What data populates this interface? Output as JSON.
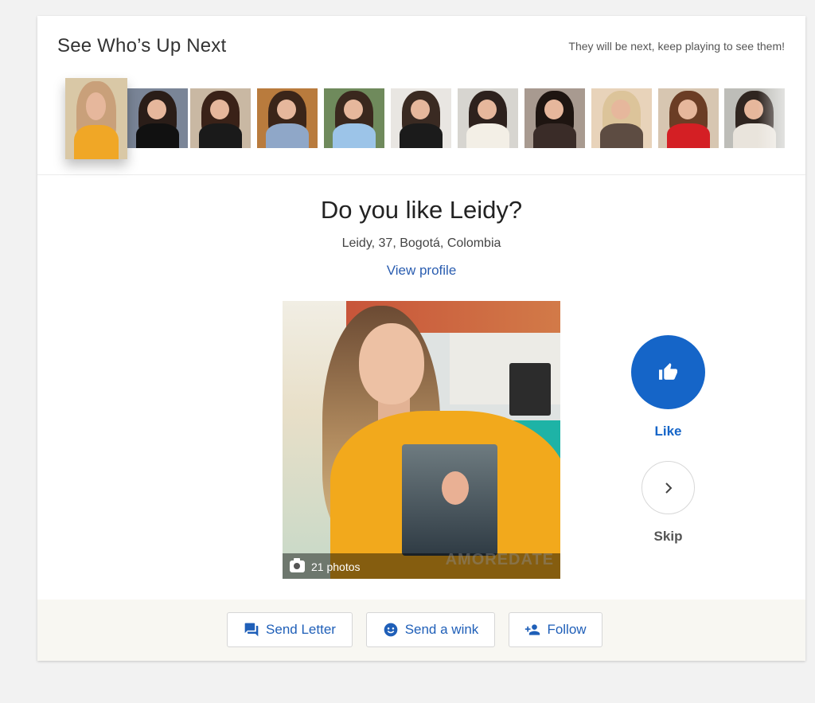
{
  "next": {
    "title": "See Who’s Up Next",
    "hint": "They will be next, keep playing to see them!",
    "thumbs": [
      {
        "bg": "#d9c8a6",
        "hair": "#c9a07a",
        "top": "#f0a726"
      },
      {
        "bg": "#7a8597",
        "hair": "#2a1d18",
        "top": "#111111"
      },
      {
        "bg": "#c9b8a3",
        "hair": "#3a2218",
        "top": "#1a1a1a"
      },
      {
        "bg": "#b97b3d",
        "hair": "#3b2519",
        "top": "#8fa7c8"
      },
      {
        "bg": "#6f8a5c",
        "hair": "#3a281e",
        "top": "#9cc4e8"
      },
      {
        "bg": "#e9e6e2",
        "hair": "#3a2a22",
        "top": "#1b1b1b"
      },
      {
        "bg": "#d7d5d0",
        "hair": "#2d211d",
        "top": "#f3efe6"
      },
      {
        "bg": "#a89a90",
        "hair": "#1e1511",
        "top": "#3a2c28"
      },
      {
        "bg": "#e8d3ba",
        "hair": "#dcc49a",
        "top": "#5d4c42"
      },
      {
        "bg": "#d7c6b1",
        "hair": "#6b3d25",
        "top": "#d41f24"
      },
      {
        "bg": "#bdbdb8",
        "hair": "#2f2520",
        "top": "#e9e4dc"
      }
    ]
  },
  "profile": {
    "question": "Do you like Leidy?",
    "details": "Leidy, 37, Bogotá, Colombia",
    "view_profile": "View profile",
    "photo_count": "21 photos",
    "watermark": "AMOREDATE"
  },
  "choice": {
    "like_label": "Like",
    "skip_label": "Skip",
    "like_color": "#1565c8"
  },
  "actions": {
    "send_letter": "Send Letter",
    "send_wink": "Send a wink",
    "follow": "Follow"
  }
}
